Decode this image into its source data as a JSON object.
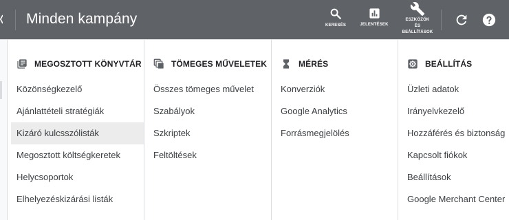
{
  "header": {
    "title": "Minden kampány",
    "tools": {
      "search_label": "KERESÉS",
      "reports_label": "JELENTÉSEK",
      "tools_label_line1": "ESZKÖZÖK",
      "tools_label_line2": "ÉS",
      "tools_label_line3": "BEÁLLÍTÁSOK"
    },
    "icons": [
      "chevron-left-icon",
      "search-icon",
      "bar-chart-icon",
      "wrench-icon",
      "refresh-icon",
      "help-icon"
    ]
  },
  "menu": {
    "columns": [
      {
        "heading": "MEGOSZTOTT KÖNYVTÁR",
        "icon": "library-icon",
        "items": [
          "Közönségkezelő",
          "Ajánlattételi stratégiák",
          "Kizáró kulcsszólisták",
          "Megosztott költségkeretek",
          "Helycsoportok",
          "Elhelyezéskizárási listák"
        ],
        "active_index": 2
      },
      {
        "heading": "TÖMEGES MŰVELETEK",
        "icon": "bulk-actions-icon",
        "items": [
          "Összes tömeges művelet",
          "Szabályok",
          "Szkriptek",
          "Feltöltések"
        ]
      },
      {
        "heading": "MÉRÉS",
        "icon": "hourglass-icon",
        "items": [
          "Konverziók",
          "Google Analytics",
          "Forrásmegjelölés"
        ]
      },
      {
        "heading": "BEÁLLÍTÁS",
        "icon": "settings-gear-icon",
        "items": [
          "Üzleti adatok",
          "Irányelvkezelő",
          "Hozzáférés és biztonság",
          "Kapcsolt fiókok",
          "Beállítások",
          "Google Merchant Center"
        ]
      }
    ]
  },
  "colors": {
    "header_bg": "#5f6368",
    "header_text": "#ffffff",
    "menu_bg": "#ffffff",
    "heading_text": "#202124",
    "item_text": "#3c4043",
    "active_item_bg": "#ececec",
    "divider": "#dadce0"
  }
}
